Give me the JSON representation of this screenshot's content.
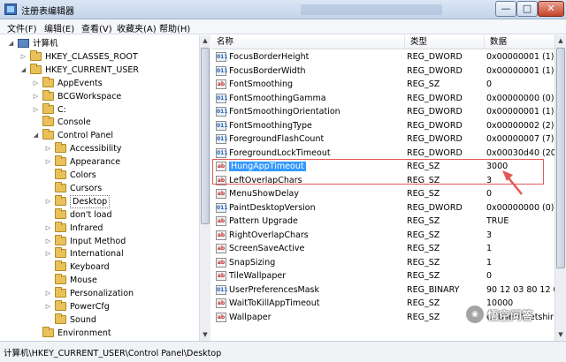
{
  "window": {
    "title": "注册表编辑器",
    "minimize_glyph": "—",
    "maximize_glyph": "□",
    "close_glyph": "✕"
  },
  "menu": [
    "文件(F)",
    "编辑(E)",
    "查看(V)",
    "收藏夹(A)",
    "帮助(H)"
  ],
  "tree": [
    {
      "label": "计算机",
      "expander": "◢",
      "icon": "computer-icon"
    },
    {
      "label": "HKEY_CLASSES_ROOT",
      "expander": "▷",
      "icon": "folder-icon"
    },
    {
      "label": "HKEY_CURRENT_USER",
      "expander": "◢",
      "icon": "folder-icon"
    },
    {
      "label": "AppEvents",
      "expander": "▷",
      "icon": "folder-icon"
    },
    {
      "label": "BCGWorkspace",
      "expander": "▷",
      "icon": "folder-icon"
    },
    {
      "label": "C:",
      "expander": "▷",
      "icon": "folder-icon"
    },
    {
      "label": "Console",
      "expander": "",
      "icon": "folder-icon"
    },
    {
      "label": "Control Panel",
      "expander": "◢",
      "icon": "folder-icon"
    },
    {
      "label": "Accessibility",
      "expander": "▷",
      "icon": "folder-icon"
    },
    {
      "label": "Appearance",
      "expander": "▷",
      "icon": "folder-icon"
    },
    {
      "label": "Colors",
      "expander": "",
      "icon": "folder-icon"
    },
    {
      "label": "Cursors",
      "expander": "",
      "icon": "folder-icon"
    },
    {
      "label": "Desktop",
      "expander": "▷",
      "icon": "folder-icon",
      "selected": true
    },
    {
      "label": "don't load",
      "expander": "",
      "icon": "folder-icon"
    },
    {
      "label": "Infrared",
      "expander": "▷",
      "icon": "folder-icon"
    },
    {
      "label": "Input Method",
      "expander": "▷",
      "icon": "folder-icon"
    },
    {
      "label": "International",
      "expander": "▷",
      "icon": "folder-icon"
    },
    {
      "label": "Keyboard",
      "expander": "",
      "icon": "folder-icon"
    },
    {
      "label": "Mouse",
      "expander": "",
      "icon": "folder-icon"
    },
    {
      "label": "Personalization",
      "expander": "▷",
      "icon": "folder-icon"
    },
    {
      "label": "PowerCfg",
      "expander": "▷",
      "icon": "folder-icon"
    },
    {
      "label": "Sound",
      "expander": "",
      "icon": "folder-icon"
    },
    {
      "label": "Environment",
      "expander": "",
      "icon": "folder-icon"
    }
  ],
  "list": {
    "headers": {
      "name": "名称",
      "type": "类型",
      "data": "数据"
    },
    "rows": [
      {
        "name": "FocusBorderHeight",
        "type": "REG_DWORD",
        "data": "0x00000001 (1)",
        "kind": "bin"
      },
      {
        "name": "FocusBorderWidth",
        "type": "REG_DWORD",
        "data": "0x00000001 (1)",
        "kind": "bin"
      },
      {
        "name": "FontSmoothing",
        "type": "REG_SZ",
        "data": "0",
        "kind": "sz"
      },
      {
        "name": "FontSmoothingGamma",
        "type": "REG_DWORD",
        "data": "0x00000000 (0)",
        "kind": "bin"
      },
      {
        "name": "FontSmoothingOrientation",
        "type": "REG_DWORD",
        "data": "0x00000001 (1)",
        "kind": "bin"
      },
      {
        "name": "FontSmoothingType",
        "type": "REG_DWORD",
        "data": "0x00000002 (2)",
        "kind": "bin"
      },
      {
        "name": "ForegroundFlashCount",
        "type": "REG_DWORD",
        "data": "0x00000007 (7)",
        "kind": "bin"
      },
      {
        "name": "ForegroundLockTimeout",
        "type": "REG_DWORD",
        "data": "0x00030d40 (20",
        "kind": "bin"
      },
      {
        "name": "HungAppTimeout",
        "type": "REG_SZ",
        "data": "3000",
        "kind": "sz",
        "selected": true
      },
      {
        "name": "LeftOverlapChars",
        "type": "REG_SZ",
        "data": "3",
        "kind": "sz"
      },
      {
        "name": "MenuShowDelay",
        "type": "REG_SZ",
        "data": "0",
        "kind": "sz"
      },
      {
        "name": "PaintDesktopVersion",
        "type": "REG_DWORD",
        "data": "0x00000000 (0)",
        "kind": "bin"
      },
      {
        "name": "Pattern Upgrade",
        "type": "REG_SZ",
        "data": "TRUE",
        "kind": "sz"
      },
      {
        "name": "RightOverlapChars",
        "type": "REG_SZ",
        "data": "3",
        "kind": "sz"
      },
      {
        "name": "ScreenSaveActive",
        "type": "REG_SZ",
        "data": "1",
        "kind": "sz"
      },
      {
        "name": "SnapSizing",
        "type": "REG_SZ",
        "data": "1",
        "kind": "sz"
      },
      {
        "name": "TileWallpaper",
        "type": "REG_SZ",
        "data": "0",
        "kind": "sz"
      },
      {
        "name": "UserPreferencesMask",
        "type": "REG_BINARY",
        "data": "90 12 03 80 12 0",
        "kind": "bin"
      },
      {
        "name": "WaitToKillAppTimeout",
        "type": "REG_SZ",
        "data": "10000",
        "kind": "sz"
      },
      {
        "name": "Wallpaper",
        "type": "REG_SZ",
        "data": "C:\\Users\\netshir",
        "kind": "sz"
      }
    ]
  },
  "icons": {
    "sz": "ab",
    "bin": "011"
  },
  "status": {
    "path": "计算机\\HKEY_CURRENT_USER\\Control Panel\\Desktop"
  },
  "watermark": {
    "logo": "◉",
    "text": "悟空问答"
  },
  "colors": {
    "selection": "#3399ff",
    "annotation": "#e45858"
  }
}
